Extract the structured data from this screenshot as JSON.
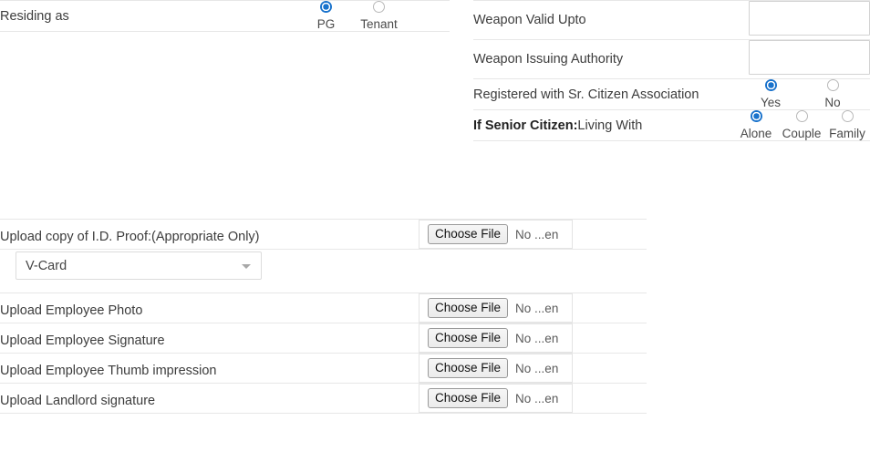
{
  "residing_section": {
    "rows": [
      {
        "label": "Residing as",
        "type": "radio",
        "options": [
          {
            "label": "PG",
            "selected": true
          },
          {
            "label": "Tenant",
            "selected": false
          }
        ]
      }
    ]
  },
  "weapon_section": {
    "rows": [
      {
        "label": "Weapon Valid Upto",
        "type": "text",
        "value": "",
        "placeholder": ""
      },
      {
        "label": "Weapon Issuing Authority",
        "type": "text",
        "value": "",
        "placeholder": ""
      },
      {
        "label": "Registered with Sr. Citizen Association",
        "type": "radio",
        "options": [
          {
            "label": "Yes",
            "selected": true
          },
          {
            "label": "No",
            "selected": false
          }
        ]
      },
      {
        "label_bold": "If Senior Citizen:",
        "label_rest": "Living With",
        "type": "radio",
        "options": [
          {
            "label": "Alone",
            "selected": true
          },
          {
            "label": "Couple",
            "selected": false
          },
          {
            "label": "Family",
            "selected": false
          }
        ]
      }
    ]
  },
  "upload_section": {
    "file_button_label": "Choose File",
    "file_status_text": "No ...en",
    "rows": [
      {
        "label": "Upload copy of I.D. Proof:(Appropriate Only)",
        "has_select": true,
        "select_value": "V-Card"
      },
      {
        "label": "Upload Employee Photo",
        "has_select": false
      },
      {
        "label": "Upload Employee Signature",
        "has_select": false
      },
      {
        "label": "Upload Employee Thumb impression",
        "has_select": false
      },
      {
        "label": "Upload Landlord signature",
        "has_select": false
      }
    ]
  },
  "colors": {
    "radio_selected": "#1a73cc",
    "border": "#e7e7e7",
    "label_text": "#3c3c3c"
  }
}
